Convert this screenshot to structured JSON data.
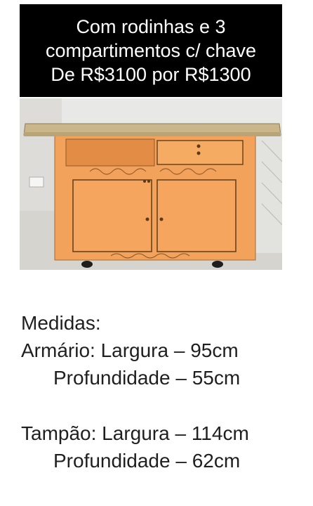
{
  "banner": {
    "line1": "Com rodinhas e 3",
    "line2": "compartimentos c/ chave",
    "line3": "De R$3100 por R$1300"
  },
  "photo": {
    "subject": "cabinet-photo",
    "colors": {
      "cabinet": "#f2a25a",
      "top": "#c9b58a",
      "wall": "#e9e9e7"
    }
  },
  "specs": {
    "heading": "Medidas:",
    "armario_width": "Armário: Largura – 95cm",
    "armario_depth": "Profundidade – 55cm",
    "tampao_width": "Tampão: Largura – 114cm",
    "tampao_depth": "Profundidade – 62cm"
  }
}
